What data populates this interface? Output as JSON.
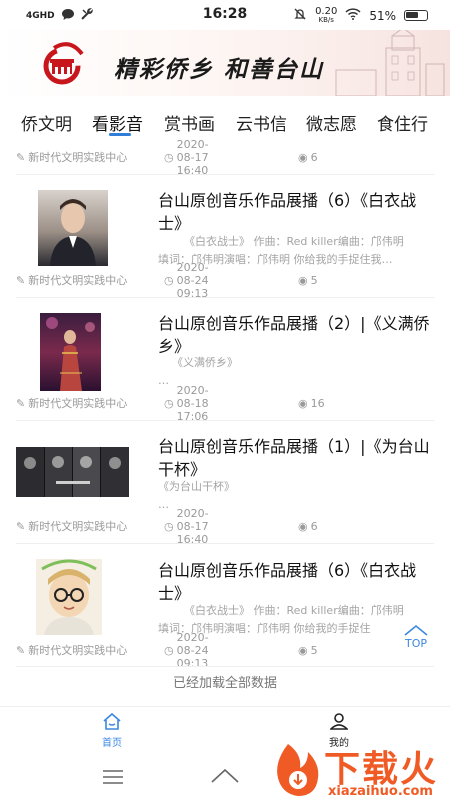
{
  "status_bar": {
    "network": "4GHD",
    "time": "16:28",
    "speed_value": "0.20",
    "speed_unit": "KB/s",
    "battery": "51%"
  },
  "banner": {
    "slogan": "精彩侨乡  和善台山"
  },
  "tabs": [
    {
      "label": "侨文明",
      "active": false
    },
    {
      "label": "看影音",
      "active": true
    },
    {
      "label": "赏书画",
      "active": false
    },
    {
      "label": "云书信",
      "active": false
    },
    {
      "label": "微志愿",
      "active": false
    },
    {
      "label": "食住行",
      "active": false
    }
  ],
  "feed": {
    "first_meta": {
      "source": "新时代文明实践中心",
      "time": "2020-08-17 16:40",
      "views": "6"
    },
    "items": [
      {
        "title": "台山原创音乐作品展播（6）《白衣战士》",
        "excerpt_1": "《白衣战士》 作曲：Red killer编曲：邝伟明",
        "excerpt_2": "填词：邝伟明演唱：邝伟明 你给我的手捉住我…",
        "source": "新时代文明实践中心",
        "time": "2020-08-24 09:13",
        "views": "5",
        "thumb": "singer-portrait"
      },
      {
        "title": "台山原创音乐作品展播（2）|《义满侨乡》",
        "excerpt_1": "《义满侨乡》",
        "excerpt_2": "…",
        "source": "新时代文明实践中心",
        "time": "2020-08-18 17:06",
        "views": "16",
        "thumb": "stage-performer"
      },
      {
        "title": "台山原创音乐作品展播（1）|《为台山干杯》",
        "excerpt_1": "《为台山干杯》",
        "excerpt_2": "…",
        "source": "新时代文明实践中心",
        "time": "2020-08-17 16:40",
        "views": "6",
        "thumb": "band-collage"
      },
      {
        "title": "台山原创音乐作品展播（6）《白衣战士》",
        "excerpt_1": "《白衣战士》 作曲：Red killer编曲：邝伟明",
        "excerpt_2": "填词：邝伟明演唱：邝伟明 你给我的手捉住",
        "source": "新时代文明实践中心",
        "time": "2020-08-24 09:13",
        "views": "5",
        "thumb": "cartoon-avatar"
      }
    ],
    "loaded_all": "已经加载全部数据"
  },
  "top_button": {
    "label": "TOP"
  },
  "bottom_nav": [
    {
      "label": "首页",
      "active": true
    },
    {
      "label": "我的",
      "active": false
    }
  ],
  "watermark": {
    "text": "下载火",
    "url": "xiazaihuo.com"
  },
  "colors": {
    "accent": "#2f7ed8",
    "meta": "#9a9a9a",
    "logo_red": "#c8161d"
  }
}
